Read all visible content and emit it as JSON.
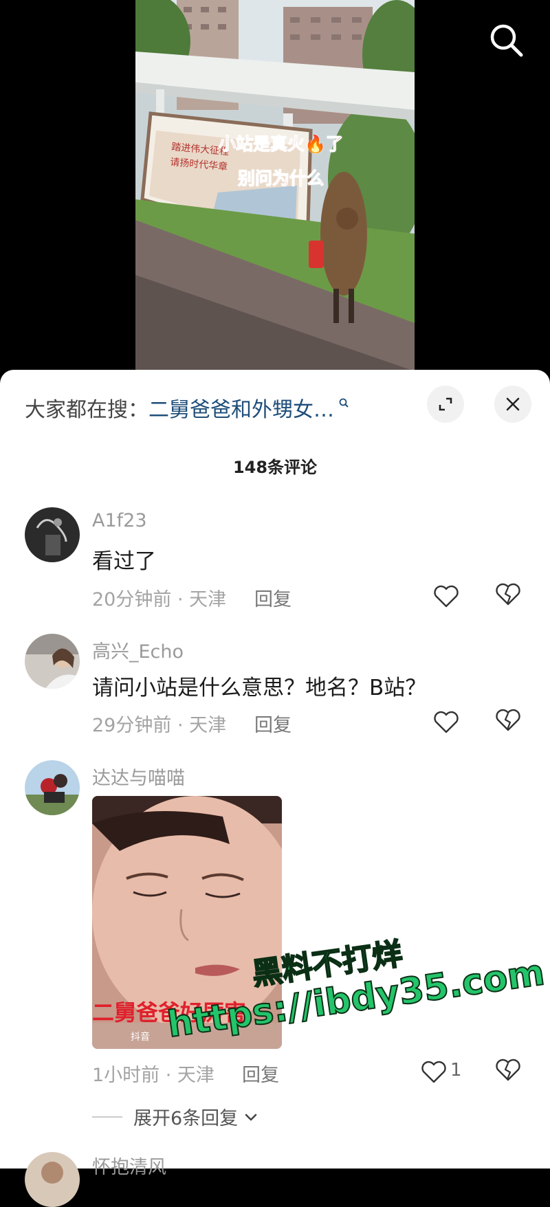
{
  "video": {
    "overlay_line1": "小站是真火🔥了",
    "overlay_line2": "别问为什么",
    "billboard_text_1": "踏进伟大征程",
    "billboard_text_2": "请扬时代华章"
  },
  "search_suggestion": {
    "prefix": "大家都在搜：",
    "query": "二舅爸爸和外甥女…"
  },
  "comment_count": "148条评论",
  "comments": [
    {
      "username": "A1f23",
      "text": "看过了",
      "meta": "20分钟前 · 天津",
      "reply_label": "回复",
      "likes": ""
    },
    {
      "username": "高兴_Echo",
      "text": "请问小站是什么意思？地名？B站？",
      "meta": "29分钟前 · 天津",
      "reply_label": "回复",
      "likes": ""
    },
    {
      "username": "达达与喵喵",
      "image_caption": "二舅爸爸好厉害",
      "image_watermark": "抖音",
      "meta": "1小时前 · 天津",
      "reply_label": "回复",
      "likes": "1",
      "expand_replies": "展开6条回复"
    },
    {
      "username": "怀抱清风"
    }
  ],
  "watermark": {
    "line1": "黑料不打烊",
    "line2": "https://ibdy35.com"
  },
  "icons": {
    "search": "search-icon",
    "expand": "expand-icon",
    "close": "close-icon",
    "like": "heart-icon",
    "dislike": "broken-heart-icon",
    "chevron": "chevron-down-icon"
  },
  "colors": {
    "query": "#1f4e7a",
    "username": "#9a9a9a",
    "caption_red": "#e8334a",
    "watermark_green": "#24c46a"
  }
}
